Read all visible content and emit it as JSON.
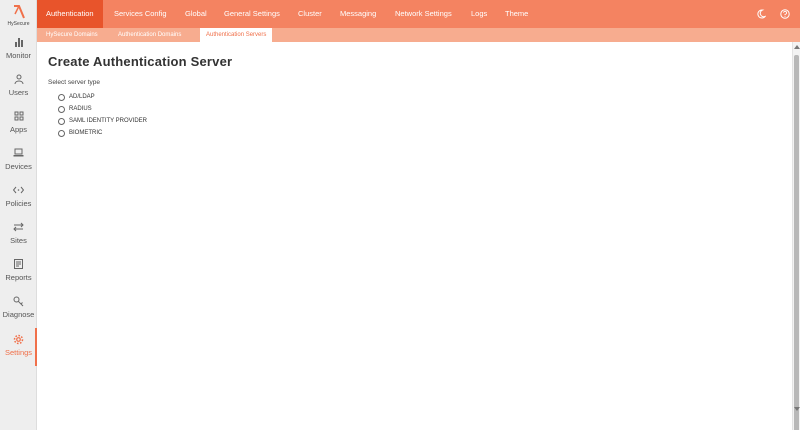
{
  "brand": {
    "name": "HySecure",
    "accent_color": "#f0704a",
    "logo_icon": "hysecure-logo"
  },
  "sidebar": {
    "items": [
      {
        "label": "Monitor",
        "icon": "bar-chart-icon"
      },
      {
        "label": "Users",
        "icon": "user-icon"
      },
      {
        "label": "Apps",
        "icon": "apps-grid-icon"
      },
      {
        "label": "Devices",
        "icon": "laptop-icon"
      },
      {
        "label": "Policies",
        "icon": "code-brackets-icon"
      },
      {
        "label": "Sites",
        "icon": "swap-arrows-icon"
      },
      {
        "label": "Reports",
        "icon": "document-icon"
      },
      {
        "label": "Diagnose",
        "icon": "key-icon"
      },
      {
        "label": "Settings",
        "icon": "gear-icon",
        "active": true
      }
    ]
  },
  "topnav": {
    "tabs": [
      {
        "label": "Authentication",
        "active": true
      },
      {
        "label": "Services Config"
      },
      {
        "label": "Global"
      },
      {
        "label": "General Settings"
      },
      {
        "label": "Cluster"
      },
      {
        "label": "Messaging"
      },
      {
        "label": "Network Settings"
      },
      {
        "label": "Logs"
      },
      {
        "label": "Theme"
      }
    ],
    "right_icons": [
      "moon-icon",
      "help-icon"
    ]
  },
  "subnav": {
    "tabs": [
      {
        "label": "HySecure Domains"
      },
      {
        "label": "Authentication Domains"
      },
      {
        "label": "Authentication Servers",
        "active": true
      }
    ]
  },
  "main": {
    "title": "Create Authentication Server",
    "section_label": "Select server type",
    "server_types": [
      {
        "label": "AD/LDAP",
        "selected": false
      },
      {
        "label": "RADIUS",
        "selected": false
      },
      {
        "label": "SAML IDENTITY PROVIDER",
        "selected": false
      },
      {
        "label": "BIOMETRIC",
        "selected": false
      }
    ]
  }
}
